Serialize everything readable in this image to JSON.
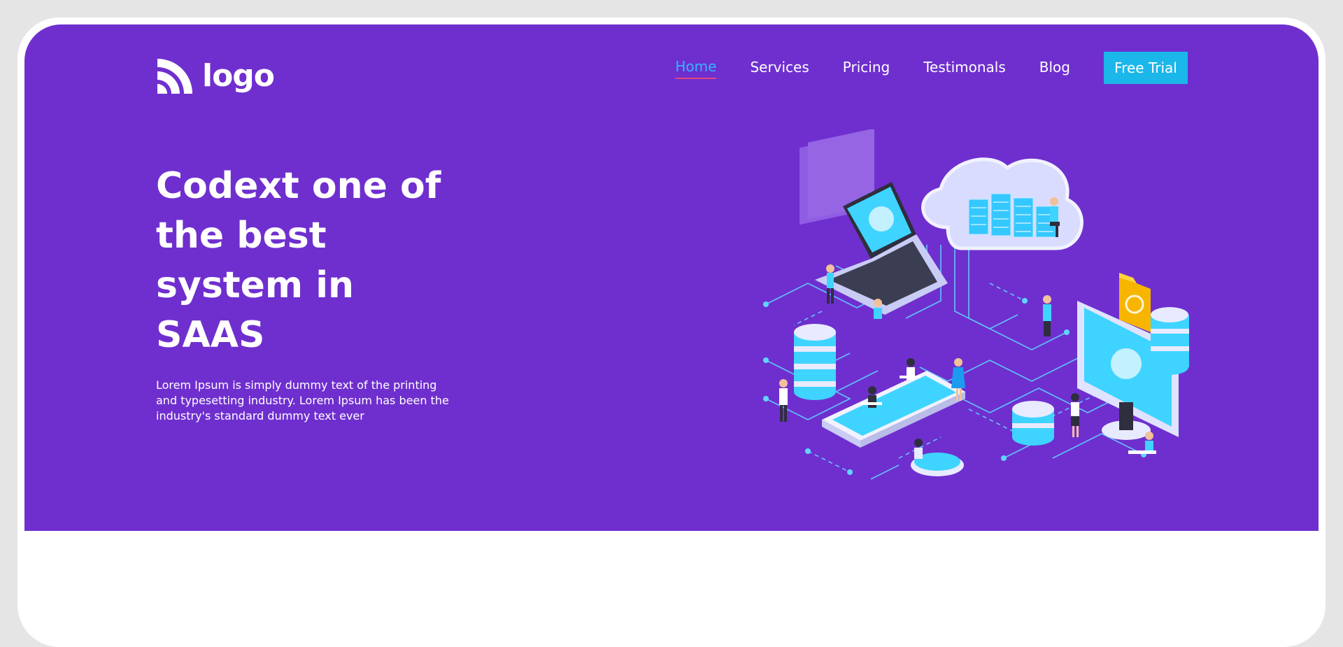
{
  "brand": {
    "logo_text": "logo"
  },
  "nav": {
    "items": [
      {
        "label": "Home",
        "active": true
      },
      {
        "label": "Services",
        "active": false
      },
      {
        "label": "Pricing",
        "active": false
      },
      {
        "label": "Testimonals",
        "active": false
      },
      {
        "label": "Blog",
        "active": false
      }
    ],
    "cta_label": "Free Trial"
  },
  "hero": {
    "headline": "Codext one of the best system in SAAS",
    "description": "Lorem Ipsum is simply dummy text of the printing and typesetting industry. Lorem Ipsum has been the industry's standard dummy text ever",
    "illustration_icon": "isometric-cloud-network-illustration"
  },
  "colors": {
    "page_bg": "#e5e5e5",
    "hero_bg": "#6f2fcf",
    "accent": "#1bb7ea",
    "nav_active": "#35b4ff",
    "nav_underline": "#e0457b"
  }
}
